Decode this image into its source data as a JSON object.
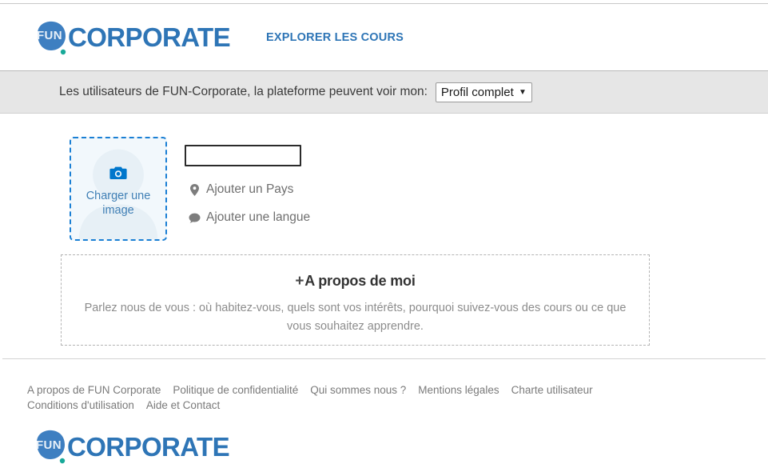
{
  "header": {
    "logo": {
      "badge_text": "FUN",
      "word": "CORPORATE"
    },
    "nav": {
      "explore_label": "EXPLORER LES COURS"
    }
  },
  "visibility": {
    "label": "Les utilisateurs de FUN-Corporate, la plateforme peuvent voir mon:",
    "selected": "Profil complet",
    "options": [
      "Profil complet"
    ],
    "arrow": "▼"
  },
  "profile": {
    "upload": {
      "label": "Charger une image",
      "icon": "camera-icon",
      "watermark": "avatar-silhouette"
    },
    "name_field": {
      "value": "",
      "placeholder": ""
    },
    "country": {
      "label": "Ajouter un Pays",
      "icon": "location-pin-icon"
    },
    "language": {
      "label": "Ajouter une langue",
      "icon": "speech-bubble-icon"
    },
    "about": {
      "plus": "+",
      "title": "A propos de moi",
      "description": "Parlez nous de vous : où habitez-vous, quels sont vos intérêts, pourquoi suivez-vous des cours ou ce que vous souhaitez apprendre."
    }
  },
  "footer": {
    "links": [
      "A propos de FUN Corporate",
      "Politique de confidentialité",
      "Qui sommes nous ?",
      "Mentions légales",
      "Charte utilisateur",
      "Conditions d'utilisation",
      "Aide et Contact"
    ],
    "logo": {
      "badge_text": "FUN",
      "word": "CORPORATE"
    }
  },
  "colors": {
    "brand_blue": "#2E75B6",
    "accent_blue": "#0077CC",
    "logo_blob": "#3E7FC1",
    "logo_dot": "#18A999",
    "bar_gray": "#e6e6e6",
    "muted_text": "#7a7a7a"
  }
}
